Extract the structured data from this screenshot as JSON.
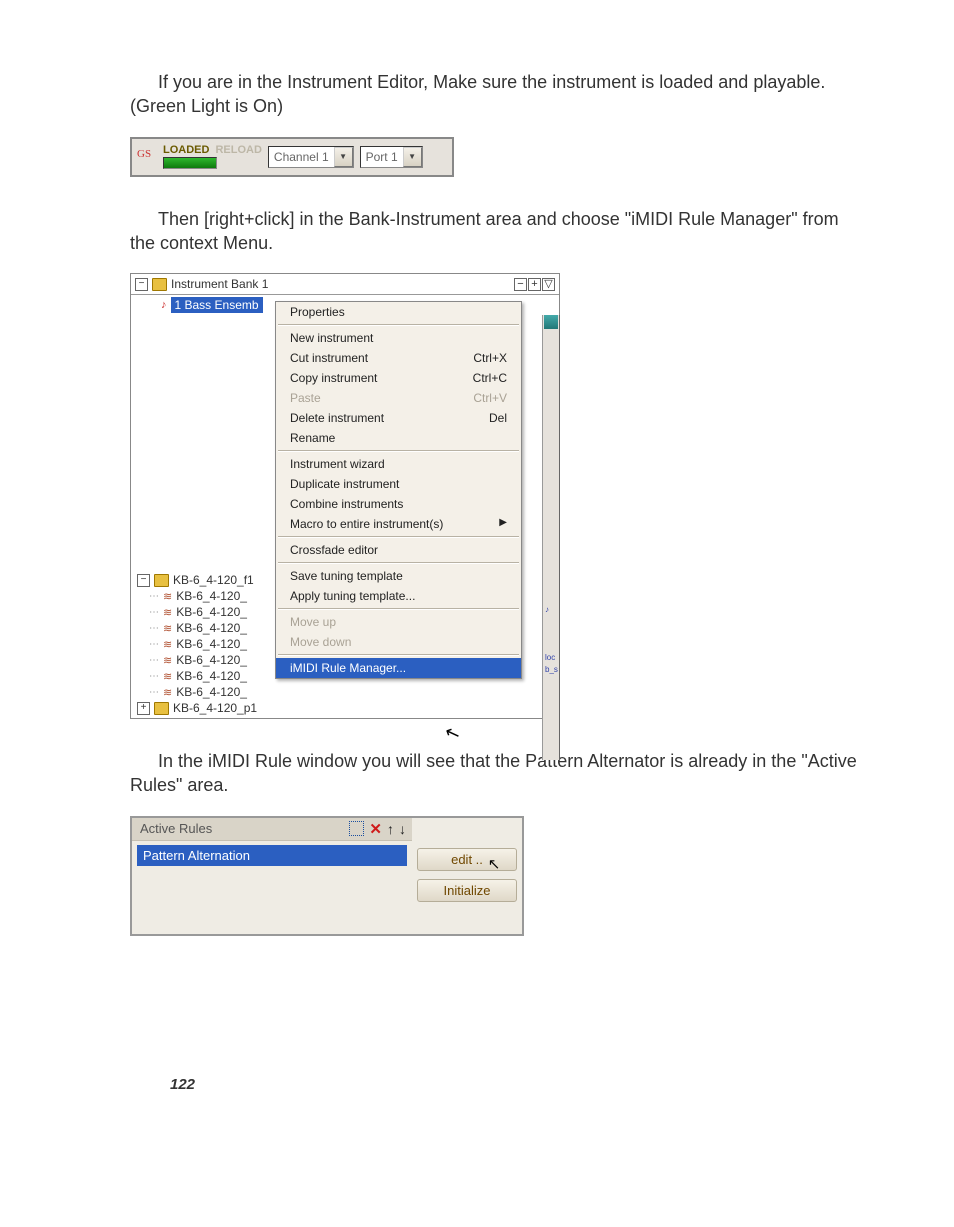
{
  "para1": "If you are in the Instrument Editor, Make sure the instrument is loaded and playable. (Green Light is On)",
  "para2": "Then [right+click] in the Bank-Instrument area and choose \"iMIDI Rule Manager\" from the context Menu.",
  "para3": "In the iMIDI Rule window you will see that the Pattern Alternator is already in the \"Active Rules\" area.",
  "page_number": "122",
  "toolbar": {
    "gs": "GS",
    "loaded": "LOADED",
    "reload": "RELOAD",
    "channel": "Channel 1",
    "port": "Port 1"
  },
  "tree": {
    "bank_header": "Instrument Bank 1",
    "sel_instrument": "1 Bass Ensemb",
    "hdr_btns": [
      "−",
      "+",
      "▽"
    ],
    "group": "KB-6_4-120_f1",
    "regions": [
      "KB-6_4-120_",
      "KB-6_4-120_",
      "KB-6_4-120_",
      "KB-6_4-120_",
      "KB-6_4-120_",
      "KB-6_4-120_",
      "KB-6_4-120_"
    ],
    "group2": "KB-6_4-120_p1",
    "strip": {
      "loc": "loc",
      "bs": "b_s"
    }
  },
  "menu": {
    "properties": "Properties",
    "new": "New instrument",
    "cut": {
      "l": "Cut instrument",
      "s": "Ctrl+X"
    },
    "copy": {
      "l": "Copy instrument",
      "s": "Ctrl+C"
    },
    "paste": {
      "l": "Paste",
      "s": "Ctrl+V"
    },
    "delete": {
      "l": "Delete instrument",
      "s": "Del"
    },
    "rename": "Rename",
    "wizard": "Instrument wizard",
    "dup": "Duplicate instrument",
    "combine": "Combine instruments",
    "macro": "Macro to entire instrument(s)",
    "xfade": "Crossfade editor",
    "savetune": "Save tuning template",
    "applytune": "Apply tuning template...",
    "moveup": "Move up",
    "movedown": "Move down",
    "imidi": "iMIDI Rule Manager..."
  },
  "rules": {
    "header": "Active Rules",
    "item": "Pattern Alternation",
    "edit": "edit ..",
    "init": "Initialize"
  }
}
